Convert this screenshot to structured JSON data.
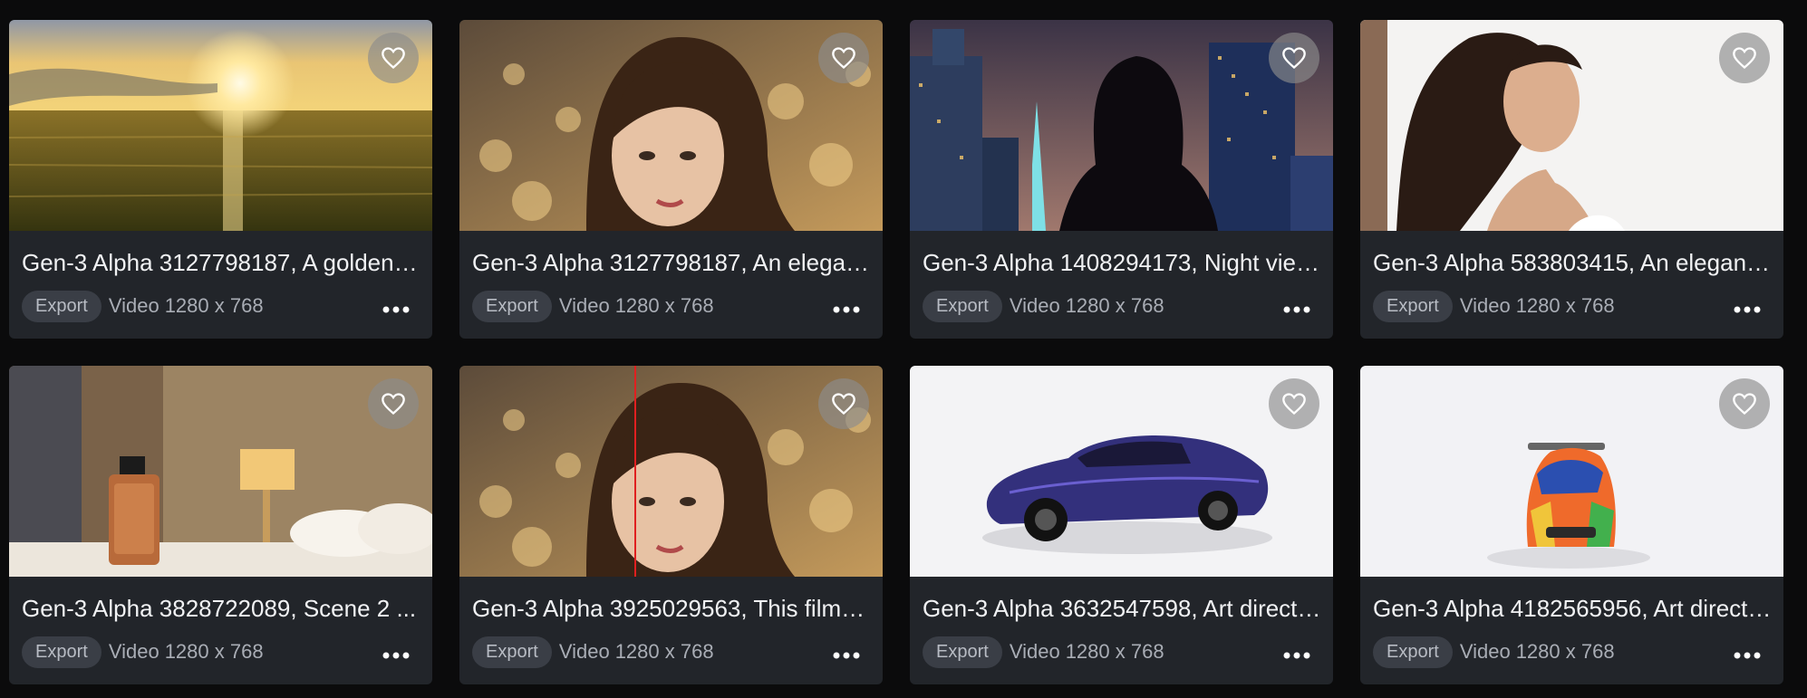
{
  "gallery": {
    "items": [
      {
        "title": "Gen-3 Alpha 3127798187, A golden s...",
        "export_label": "Export",
        "type": "Video",
        "resolution": "1280 x 768",
        "favorite_icon": "heart-outline-icon",
        "more_icon": "more-horizontal-icon"
      },
      {
        "title": "Gen-3 Alpha 3127798187, An elegant ...",
        "export_label": "Export",
        "type": "Video",
        "resolution": "1280 x 768",
        "favorite_icon": "heart-outline-icon",
        "more_icon": "more-horizontal-icon"
      },
      {
        "title": "Gen-3 Alpha 1408294173, Night view...",
        "export_label": "Export",
        "type": "Video",
        "resolution": "1280 x 768",
        "favorite_icon": "heart-outline-icon",
        "more_icon": "more-horizontal-icon"
      },
      {
        "title": "Gen-3 Alpha 583803415, An elegant ...",
        "export_label": "Export",
        "type": "Video",
        "resolution": "1280 x 768",
        "favorite_icon": "heart-outline-icon",
        "more_icon": "more-horizontal-icon"
      },
      {
        "title": "Gen-3 Alpha 3828722089, Scene 2 ...",
        "export_label": "Export",
        "type": "Video",
        "resolution": "1280 x 768",
        "favorite_icon": "heart-outline-icon",
        "more_icon": "more-horizontal-icon"
      },
      {
        "title": "Gen-3 Alpha 3925029563, This film i...",
        "export_label": "Export",
        "type": "Video",
        "resolution": "1280 x 768",
        "favorite_icon": "heart-outline-icon",
        "more_icon": "more-horizontal-icon"
      },
      {
        "title": "Gen-3 Alpha 3632547598, Art directi...",
        "export_label": "Export",
        "type": "Video",
        "resolution": "1280 x 768",
        "favorite_icon": "heart-outline-icon",
        "more_icon": "more-horizontal-icon"
      },
      {
        "title": "Gen-3 Alpha 4182565956, Art directi...",
        "export_label": "Export",
        "type": "Video",
        "resolution": "1280 x 768",
        "favorite_icon": "heart-outline-icon",
        "more_icon": "more-horizontal-icon"
      }
    ]
  },
  "colors": {
    "background": "#0b0b0c",
    "card": "#22252a",
    "pill": "#3a3e46"
  }
}
